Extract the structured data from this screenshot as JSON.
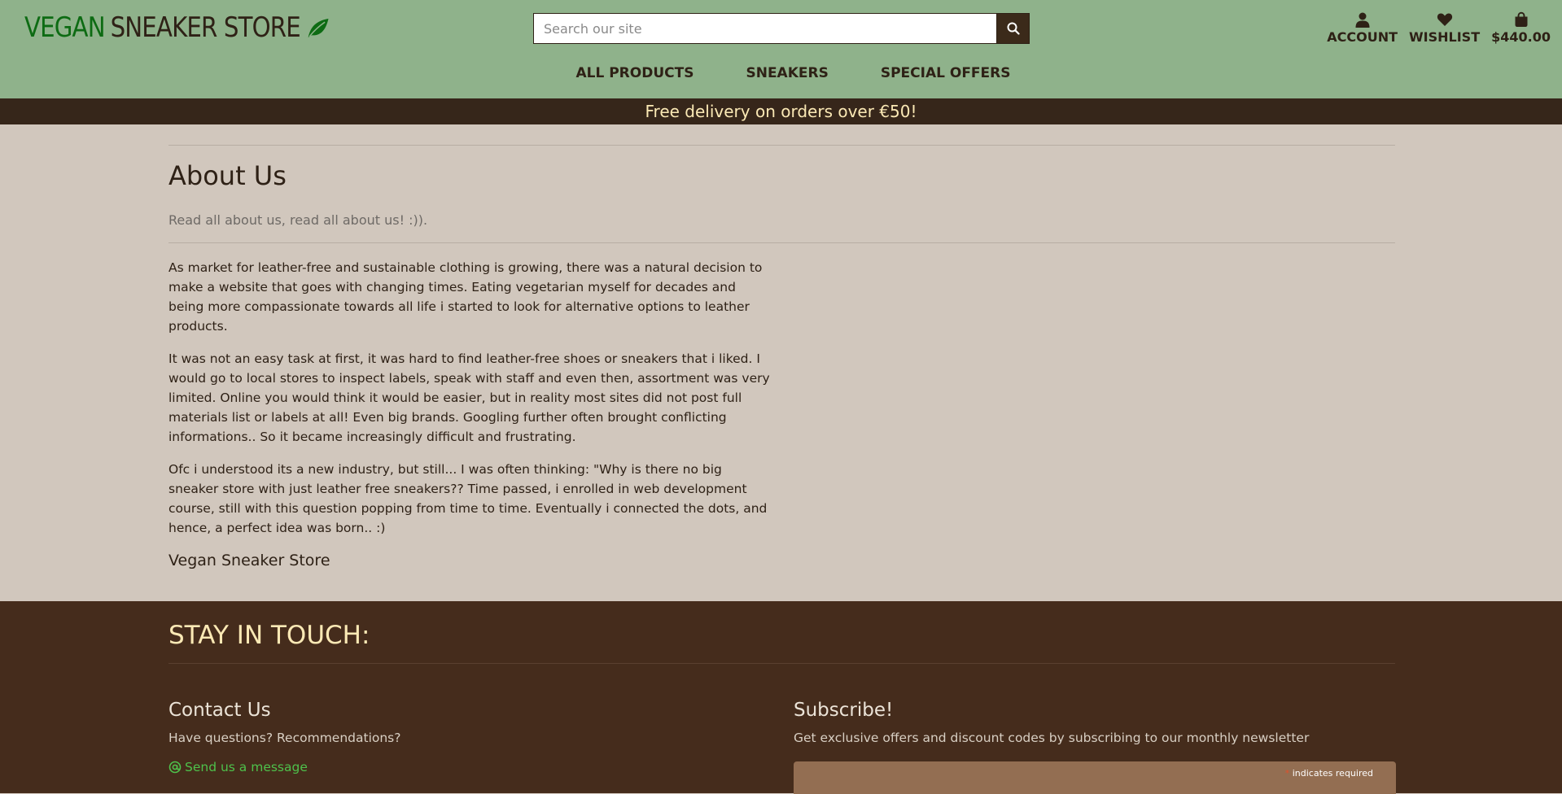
{
  "header": {
    "logo_vegan": "VEGAN",
    "logo_rest": "SNEAKER STORE",
    "leaf_icon": "leaf-icon",
    "search_placeholder": "Search our site",
    "account_label": "ACCOUNT",
    "wishlist_label": "WISHLIST",
    "bag_total": "$440.00",
    "colors": {
      "bg": "#8fb28b",
      "logo_green": "#0d6b13"
    }
  },
  "nav": {
    "items": [
      "ALL PRODUCTS",
      "SNEAKERS",
      "SPECIAL OFFERS"
    ]
  },
  "banner": {
    "text": "Free delivery on orders over €50!"
  },
  "about": {
    "title": "About Us",
    "subtitle": "Read all about us, read all about us! :)).",
    "paragraphs": [
      "As market for leather-free and sustainable clothing is growing, there was a natural decision to make a website that goes with changing times. Eating vegetarian myself for decades and being more compassionate towards all life i started to look for alternative options to leather products.",
      "It was not an easy task at first, it was hard to find leather-free shoes or sneakers that i liked. I would go to local stores to inspect labels, speak with staff and even then, assortment was very limited. Online you would think it would be easier, but in reality most sites did not post full materials list or labels at all! Even big brands. Googling further often brought conflicting informations.. So it became increasingly difficult and frustrating.",
      "Ofc i understood its a new industry, but still... I was often thinking: \"Why is there no big sneaker store with just leather free sneakers?? Time passed, i enrolled in web development course, still with this question popping from time to time. Eventually i connected the dots, and hence, a perfect idea was born.. :)"
    ],
    "signature": "Vegan Sneaker Store"
  },
  "footer": {
    "heading": "STAY IN TOUCH:",
    "contact": {
      "title": "Contact Us",
      "text": "Have questions? Recommendations?",
      "link": "Send us a message"
    },
    "subscribe": {
      "title": "Subscribe!",
      "text": "Get exclusive offers and discount codes by subscribing to our monthly newsletter",
      "required_note": "indicates required"
    }
  }
}
